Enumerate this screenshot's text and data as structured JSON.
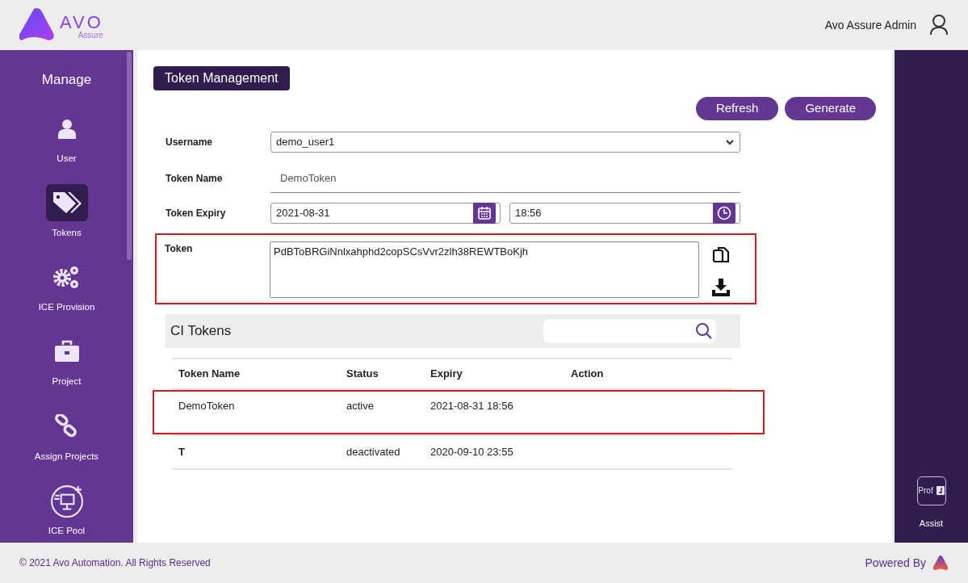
{
  "header": {
    "logo": {
      "brand": "AVO",
      "product": "Assure"
    },
    "user_name": "Avo Assure Admin"
  },
  "sidebar": {
    "title": "Manage",
    "items": [
      {
        "label": "User",
        "kind": "user",
        "selected": false
      },
      {
        "label": "Tokens",
        "kind": "tag",
        "selected": true
      },
      {
        "label": "ICE Provision",
        "kind": "gears",
        "selected": false
      },
      {
        "label": "Project",
        "kind": "briefcase",
        "selected": false
      },
      {
        "label": "Assign Projects",
        "kind": "link",
        "selected": false
      },
      {
        "label": "ICE Pool",
        "kind": "pool",
        "selected": false
      }
    ]
  },
  "page": {
    "title": "Token Management",
    "buttons": [
      "Refresh",
      "Generate"
    ],
    "form": {
      "username": {
        "label": "Username",
        "value": "demo_user1"
      },
      "token_name": {
        "label": "Token Name",
        "value": "DemoToken"
      },
      "token_expiry": {
        "label": "Token Expiry",
        "date": "2021-08-31",
        "time": "18:56"
      },
      "token": {
        "label": "Token",
        "value": "PdBToBRGiNnlxahphd2copSCsVvr2zlh38REWTBoKjh",
        "highlighted": true
      }
    },
    "ci_tokens": {
      "title": "CI Tokens",
      "columns": [
        "Token Name",
        "Status",
        "Expiry",
        "Action"
      ],
      "rows": [
        {
          "name": "DemoToken",
          "status": "active",
          "expiry": "2021-08-31 18:56",
          "highlighted": true
        },
        {
          "name": "T",
          "status": "deactivated",
          "expiry": "2020-09-10 23:55",
          "highlighted": false
        }
      ]
    }
  },
  "right_panel": {
    "badge": "Prof",
    "label": "Assist"
  },
  "footer": {
    "copyright": "© 2021 Avo Automation. All Rights Reserved",
    "powered_by": "Powered By"
  }
}
